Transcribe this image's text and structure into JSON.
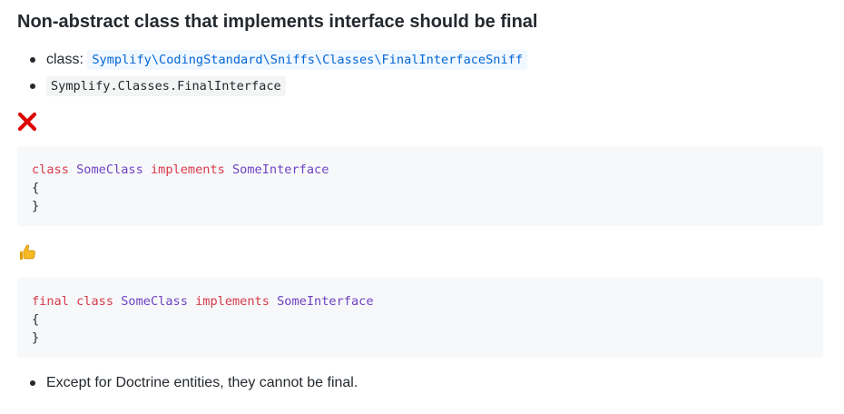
{
  "heading": "Non-abstract class that implements interface should be final",
  "meta": {
    "class_label": "class:",
    "class_value": "Symplify\\CodingStandard\\Sniffs\\Classes\\FinalInterfaceSniff",
    "sniff_code": "Symplify.Classes.FinalInterface"
  },
  "bad_example": {
    "icon": "cross-mark-icon",
    "line1": {
      "kw1": "class",
      "name1": "SomeClass",
      "kw2": "implements",
      "name2": "SomeInterface"
    },
    "line2": "{",
    "line3": "}"
  },
  "good_example": {
    "icon": "thumbs-up-icon",
    "line1": {
      "kw0": "final",
      "kw1": "class",
      "name1": "SomeClass",
      "kw2": "implements",
      "name2": "SomeInterface"
    },
    "line2": "{",
    "line3": "}"
  },
  "notes": [
    "Except for Doctrine entities, they cannot be final."
  ],
  "colors": {
    "keyword": "#d73a49",
    "name": "#6f42c1",
    "link": "#0366d6",
    "cross": "#dd0000"
  }
}
